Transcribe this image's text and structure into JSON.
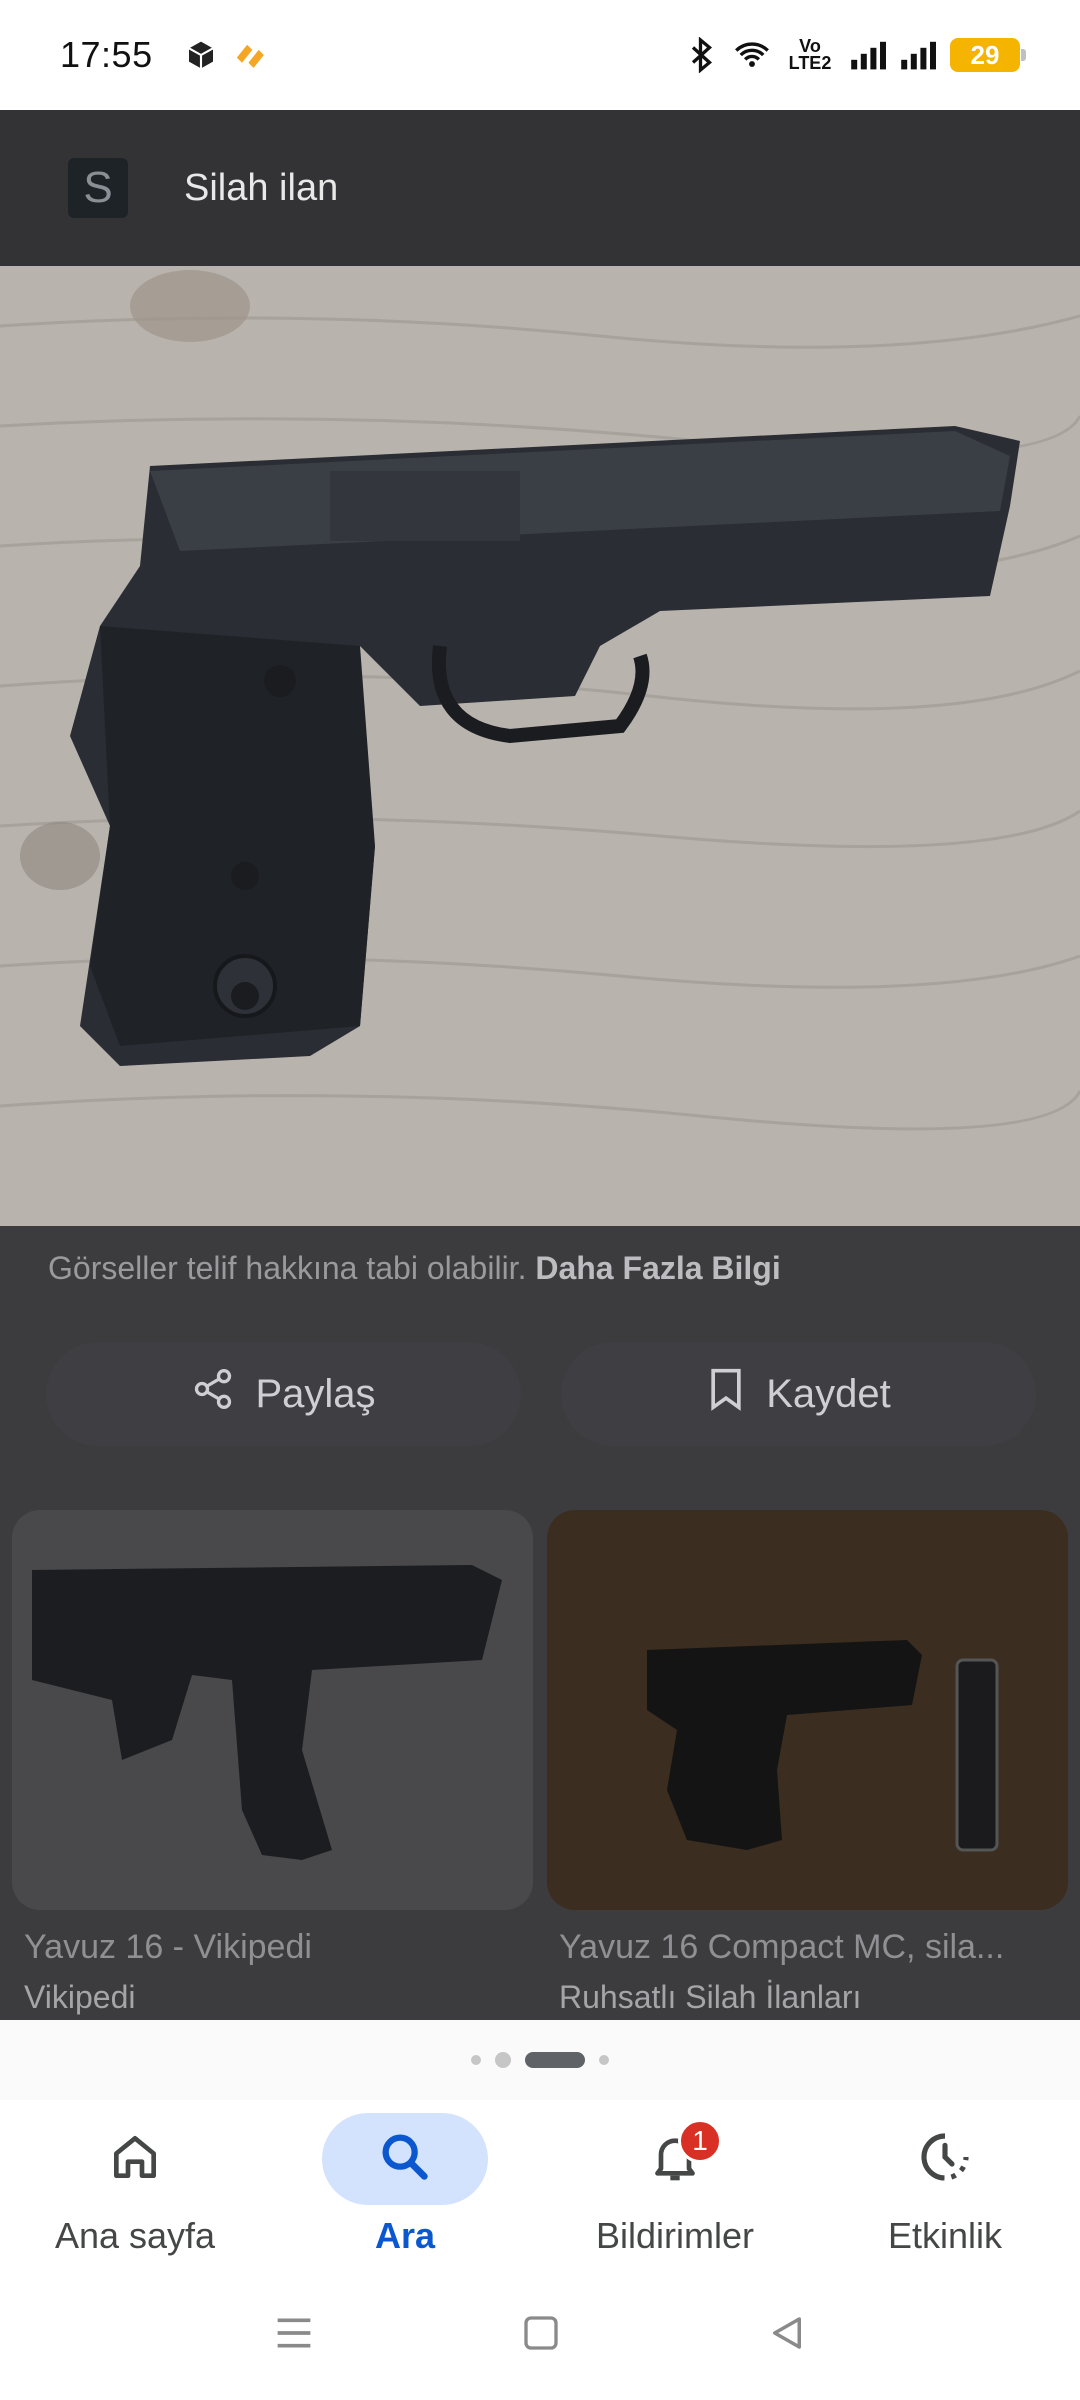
{
  "status_bar": {
    "time": "17:55",
    "network": "Vo LTE2",
    "battery": "29"
  },
  "header": {
    "site_initial": "S",
    "title": "Silah ilan"
  },
  "copyright": {
    "text": "Görseller telif hakkına tabi olabilir.",
    "link": "Daha Fazla Bilgi"
  },
  "actions": {
    "share_label": "Paylaş",
    "save_label": "Kaydet"
  },
  "related": [
    {
      "title": "Yavuz 16 - Vikipedi",
      "source": "Vikipedi"
    },
    {
      "title": "Yavuz 16 Compact MC, sila...",
      "source": "Ruhsatlı Silah İlanları"
    }
  ],
  "bottom_nav": {
    "items": [
      {
        "label": "Ana sayfa",
        "icon": "home-icon"
      },
      {
        "label": "Ara",
        "icon": "search-icon"
      },
      {
        "label": "Bildirimler",
        "icon": "bell-icon",
        "badge": "1"
      },
      {
        "label": "Etkinlik",
        "icon": "activity-icon"
      }
    ],
    "active_index": 1
  },
  "colors": {
    "accent": "#0b57d0",
    "accent_bg": "#d3e3fd",
    "badge": "#d93025",
    "battery": "#f4b400"
  }
}
